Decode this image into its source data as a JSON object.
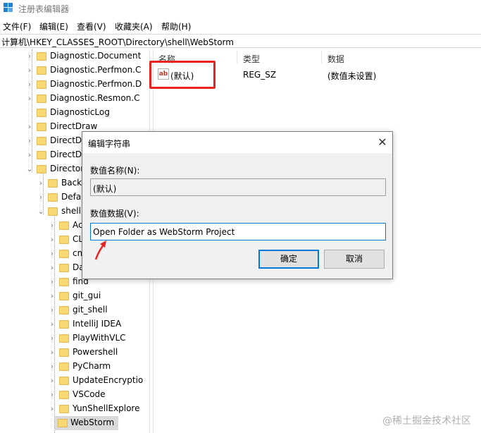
{
  "window": {
    "title": "注册表编辑器"
  },
  "menu": [
    "文件(F)",
    "编辑(E)",
    "查看(V)",
    "收藏夹(A)",
    "帮助(H)"
  ],
  "address": "计算机\\HKEY_CLASSES_ROOT\\Directory\\shell\\WebStorm",
  "tree": [
    {
      "label": "Diagnostic.Document",
      "level": 1,
      "chevron": "right"
    },
    {
      "label": "Diagnostic.Perfmon.C",
      "level": 1,
      "chevron": "right"
    },
    {
      "label": "Diagnostic.Perfmon.D",
      "level": 1,
      "chevron": "right"
    },
    {
      "label": "Diagnostic.Resmon.C",
      "level": 1,
      "chevron": "right"
    },
    {
      "label": "DiagnosticLog",
      "level": 1,
      "chevron": "none"
    },
    {
      "label": "DirectDraw",
      "level": 1,
      "chevron": "right"
    },
    {
      "label": "DirectDr",
      "level": 1,
      "chevron": "right"
    },
    {
      "label": "DirectDr",
      "level": 1,
      "chevron": "right"
    },
    {
      "label": "Director",
      "level": 1,
      "chevron": "down"
    },
    {
      "label": "Back",
      "level": 2,
      "chevron": "right"
    },
    {
      "label": "Defa",
      "level": 2,
      "chevron": "right"
    },
    {
      "label": "shell",
      "level": 2,
      "chevron": "down"
    },
    {
      "label": "Ac",
      "level": 3,
      "chevron": "right"
    },
    {
      "label": "CL",
      "level": 3,
      "chevron": "right"
    },
    {
      "label": "cm",
      "level": 3,
      "chevron": "right"
    },
    {
      "label": "Da",
      "level": 3,
      "chevron": "right"
    },
    {
      "label": "find",
      "level": 3,
      "chevron": "right"
    },
    {
      "label": "git_gui",
      "level": 3,
      "chevron": "right"
    },
    {
      "label": "git_shell",
      "level": 3,
      "chevron": "right"
    },
    {
      "label": "IntelliJ IDEA",
      "level": 3,
      "chevron": "right"
    },
    {
      "label": "PlayWithVLC",
      "level": 3,
      "chevron": "right"
    },
    {
      "label": "Powershell",
      "level": 3,
      "chevron": "right"
    },
    {
      "label": "PyCharm",
      "level": 3,
      "chevron": "right"
    },
    {
      "label": "UpdateEncryptio",
      "level": 3,
      "chevron": "right"
    },
    {
      "label": "VSCode",
      "level": 3,
      "chevron": "right"
    },
    {
      "label": "YunShellExplore",
      "level": 3,
      "chevron": "right"
    },
    {
      "label": "WebStorm",
      "level": 3,
      "chevron": "none",
      "selected": true
    }
  ],
  "list": {
    "headers": {
      "name": "名称",
      "type": "类型",
      "data": "数据"
    },
    "rows": [
      {
        "icon": "ab",
        "name": "(默认)",
        "type": "REG_SZ",
        "data": "(数值未设置)"
      }
    ]
  },
  "dialog": {
    "title": "编辑字符串",
    "name_label": "数值名称(N):",
    "name_value": "(默认)",
    "data_label": "数值数据(V):",
    "data_value": "Open Folder as WebStorm Project",
    "ok_label": "确定",
    "cancel_label": "取消",
    "close_glyph": "✕"
  },
  "watermark": "@稀土掘金技术社区",
  "colors": {
    "highlight": "#e8231f",
    "accent": "#0078d7",
    "folder": "#f8d775"
  }
}
